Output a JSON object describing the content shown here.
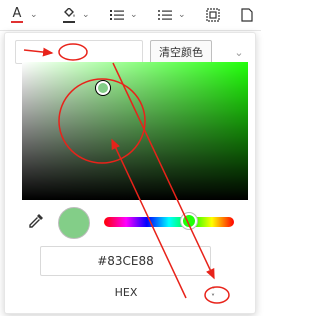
{
  "toolbar": {
    "items": [
      {
        "icon": "font-color-icon",
        "glyph": "A"
      },
      {
        "icon": "fill-color-icon",
        "glyph": "◆"
      },
      {
        "icon": "ordered-list-icon",
        "glyph": "☰"
      },
      {
        "icon": "bullet-list-icon",
        "glyph": "☰"
      },
      {
        "icon": "table-icon",
        "glyph": "⊞"
      },
      {
        "icon": "page-icon",
        "glyph": "▯"
      }
    ],
    "font_color_underline": "#e03131"
  },
  "picker": {
    "clear_label": "清空颜色",
    "hex_value": "#83CE88",
    "mode_label": "HEX",
    "toggle_glyph_up": "˄",
    "toggle_glyph_down": "˅",
    "selected_color": "#83CE88",
    "hue_color": "#21ff0a",
    "saturation": 0.36,
    "value": 0.81,
    "hue_position": 0.65
  },
  "annotation_color": "#e8231a"
}
